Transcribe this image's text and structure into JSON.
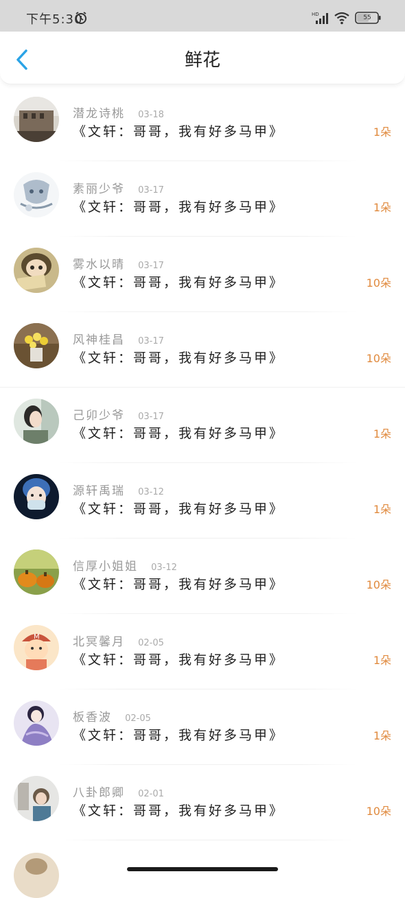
{
  "status_bar": {
    "time": "下午5:30",
    "battery": "55",
    "icons": [
      "alarm-icon",
      "signal-icon",
      "wifi-icon",
      "battery-icon"
    ]
  },
  "header": {
    "title": "鲜花",
    "back_icon": "chevron-left-icon",
    "accent_color": "#2aa3e6"
  },
  "colors": {
    "count": "#e08a3e",
    "username": "#999999",
    "title": "#222222"
  },
  "items": [
    {
      "user": "潜龙诗桃",
      "date": "03-18",
      "book": "《文轩：哥哥，我有好多马甲》",
      "count": "1朵",
      "avatar": "city-photo"
    },
    {
      "user": "素丽少爷",
      "date": "03-17",
      "book": "《文轩：哥哥，我有好多马甲》",
      "count": "1朵",
      "avatar": "anime-sketch"
    },
    {
      "user": "雾水以晴",
      "date": "03-17",
      "book": "《文轩：哥哥，我有好多马甲》",
      "count": "10朵",
      "avatar": "doll-sign"
    },
    {
      "user": "风神桂昌",
      "date": "03-17",
      "book": "《文轩：哥哥，我有好多马甲》",
      "count": "10朵",
      "avatar": "flower-pot"
    },
    {
      "user": "己卯少爷",
      "date": "03-17",
      "book": "《文轩：哥哥，我有好多马甲》",
      "count": "1朵",
      "avatar": "girl-profile"
    },
    {
      "user": "源轩禹瑞",
      "date": "03-12",
      "book": "《文轩：哥哥，我有好多马甲》",
      "count": "1朵",
      "avatar": "masked-boy"
    },
    {
      "user": "信厚小姐姐",
      "date": "03-12",
      "book": "《文轩：哥哥，我有好多马甲》",
      "count": "10朵",
      "avatar": "pumpkins"
    },
    {
      "user": "北冥馨月",
      "date": "02-05",
      "book": "《文轩：哥哥，我有好多马甲》",
      "count": "1朵",
      "avatar": "cartoon-boy"
    },
    {
      "user": "板香波",
      "date": "02-05",
      "book": "《文轩：哥哥，我有好多马甲》",
      "count": "1朵",
      "avatar": "anime-lady"
    },
    {
      "user": "八卦郎卿",
      "date": "02-01",
      "book": "《文轩：哥哥，我有好多马甲》",
      "count": "10朵",
      "avatar": "child-photo"
    }
  ]
}
